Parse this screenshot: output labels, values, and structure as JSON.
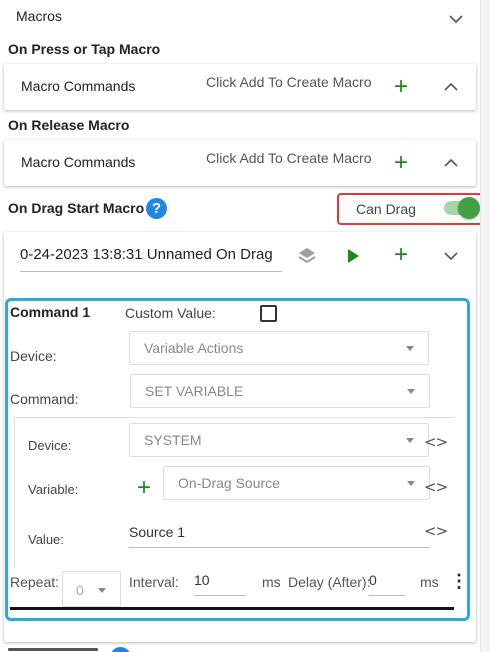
{
  "top": {
    "title": "Macros"
  },
  "on_press": {
    "section_label": "On Press or Tap Macro",
    "row_label": "Macro Commands",
    "hint": "Click Add To Create Macro"
  },
  "on_release": {
    "section_label": "On Release Macro",
    "row_label": "Macro Commands",
    "hint": "Click Add To Create Macro"
  },
  "on_drag_start": {
    "section_label": "On Drag Start Macro",
    "help": "?",
    "can_drag_label": "Can Drag",
    "can_drag_enabled": true,
    "macro_name": "0-24-2023 13:8:31 Unnamed On Drag"
  },
  "command": {
    "title": "Command 1",
    "custom_value_label": "Custom Value:",
    "custom_value_checked": false,
    "device_label": "Device:",
    "device_value": "Variable Actions",
    "command_label": "Command:",
    "command_value": "SET VARIABLE",
    "sub_device_label": "Device:",
    "sub_device_value": "SYSTEM",
    "variable_label": "Variable:",
    "variable_value": "On-Drag Source",
    "value_label": "Value:",
    "value_value": "Source 1",
    "code_symbol": "<>",
    "repeat_label": "Repeat:",
    "repeat_value": "0",
    "interval_label": "Interval:",
    "interval_value": "10",
    "interval_unit": "ms",
    "delay_label": "Delay (After):",
    "delay_value": "0",
    "delay_unit": "ms",
    "more": "⋮"
  },
  "plus_symbol": "+",
  "colors": {
    "accent_green": "#1a8a1a",
    "toggle_green": "#43a047",
    "help_blue": "#1e88e5",
    "highlight_red": "#e53935",
    "highlight_blue": "#29aadf"
  }
}
